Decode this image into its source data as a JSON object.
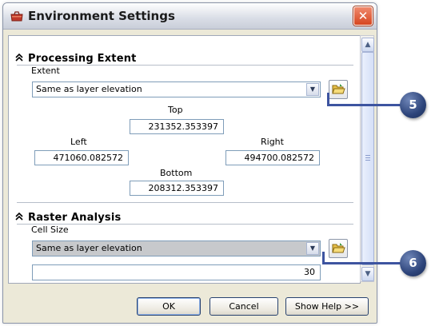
{
  "window": {
    "title": "Environment Settings",
    "close_glyph": "✕"
  },
  "processing_extent": {
    "heading": "Processing Extent",
    "extent_label": "Extent",
    "extent_value": "Same as layer elevation",
    "top_label": "Top",
    "top_value": "231352.353397",
    "left_label": "Left",
    "left_value": "471060.082572",
    "right_label": "Right",
    "right_value": "494700.082572",
    "bottom_label": "Bottom",
    "bottom_value": "208312.353397"
  },
  "raster_analysis": {
    "heading": "Raster Analysis",
    "cell_size_label": "Cell Size",
    "cell_size_option": "Same as layer elevation",
    "cell_size_value": "30"
  },
  "buttons": {
    "ok": "OK",
    "cancel": "Cancel",
    "show_help": "Show Help >>"
  },
  "callouts": {
    "first": "5",
    "second": "6"
  },
  "icons": {
    "app": "toolbox-icon",
    "collapse": "double-chevron-up-icon",
    "folder": "open-folder-icon",
    "dropdown": "chevron-down-icon"
  },
  "colors": {
    "callout_fill": "#2d447a",
    "leader_line": "#3d54a0",
    "close_button": "#d6451f"
  }
}
